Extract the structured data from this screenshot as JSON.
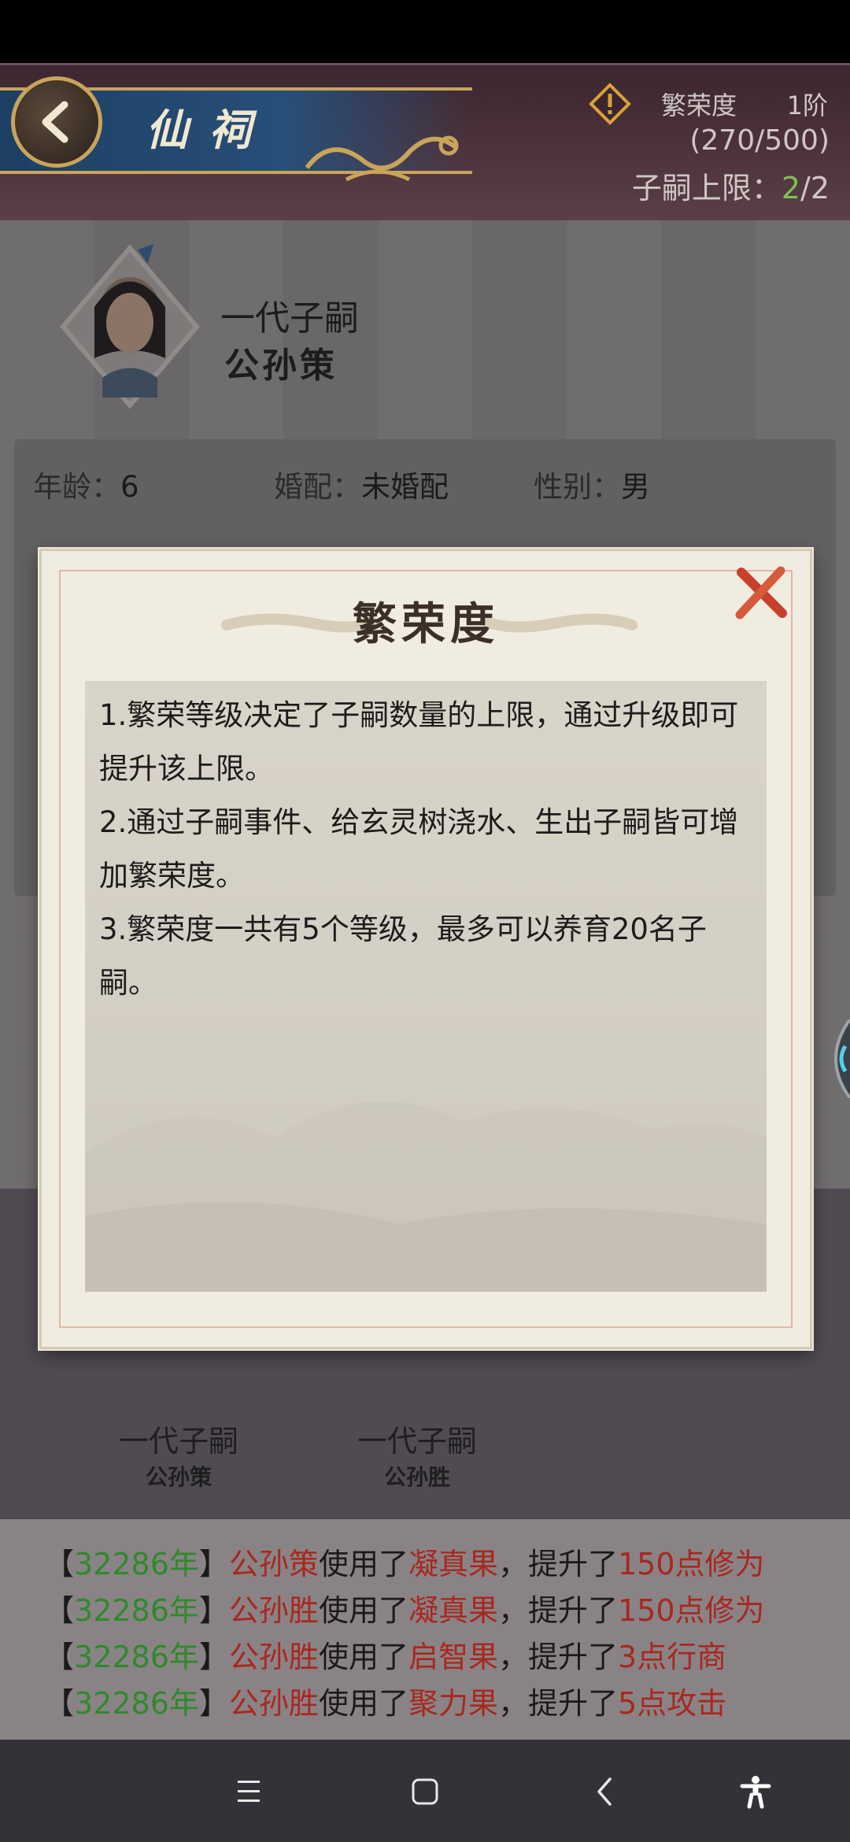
{
  "header": {
    "title": "仙祠",
    "prosperity_label": "繁荣度",
    "prosperity_level": "1阶",
    "prosperity_count": "(270/500)",
    "heir_limit_label": "子嗣上限：",
    "heir_limit_current": "2",
    "heir_limit_max": "/2"
  },
  "profile": {
    "generation": "一代子嗣",
    "name": "公孙策",
    "age_label": "年龄：",
    "age_value": "6",
    "marriage_label": "婚配：",
    "marriage_value": "未婚配",
    "gender_label": "性别：",
    "gender_value": "男"
  },
  "heirs": [
    {
      "generation": "一代子嗣",
      "name": "公孙策"
    },
    {
      "generation": "一代子嗣",
      "name": "公孙胜"
    }
  ],
  "log": [
    {
      "year": "32286年",
      "who": "公孙策",
      "verb": "使用了",
      "item": "凝真果",
      "mid": "，提升了",
      "effect": "150点修为"
    },
    {
      "year": "32286年",
      "who": "公孙胜",
      "verb": "使用了",
      "item": "凝真果",
      "mid": "，提升了",
      "effect": "150点修为"
    },
    {
      "year": "32286年",
      "who": "公孙胜",
      "verb": "使用了",
      "item": "启智果",
      "mid": "，提升了",
      "effect": "3点行商"
    },
    {
      "year": "32286年",
      "who": "公孙胜",
      "verb": "使用了",
      "item": "聚力果",
      "mid": "，提升了",
      "effect": "5点攻击"
    }
  ],
  "brackets": {
    "open": "【",
    "close": "】"
  },
  "modal": {
    "title": "繁荣度",
    "tip1": "1.繁荣等级决定了子嗣数量的上限，通过升级即可提升该上限。",
    "tip2": "2.通过子嗣事件、给玄灵树浇水、生出子嗣皆可增加繁荣度。",
    "tip3": "3.繁荣度一共有5个等级，最多可以养育20名子嗣。"
  },
  "colors": {
    "accent_green": "#7cc249",
    "log_year_green": "#2e8a2a",
    "log_red": "#a8281e",
    "close_red": "#c8402c"
  }
}
